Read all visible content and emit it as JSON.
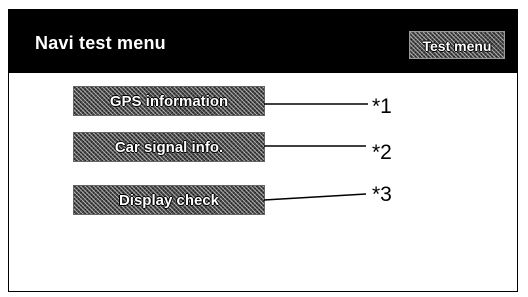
{
  "header": {
    "title": "Navi test menu",
    "tab_label": "Test menu"
  },
  "menu": {
    "items": [
      {
        "label": "GPS information",
        "callout": "*1"
      },
      {
        "label": "Car signal info.",
        "callout": "*2"
      },
      {
        "label": "Display check",
        "callout": "*3"
      }
    ]
  },
  "colors": {
    "header_bg": "#000000",
    "screen_bg": "#ffffff",
    "button_fill": "#4a4a4a",
    "text_on_dark": "#ffffff"
  }
}
